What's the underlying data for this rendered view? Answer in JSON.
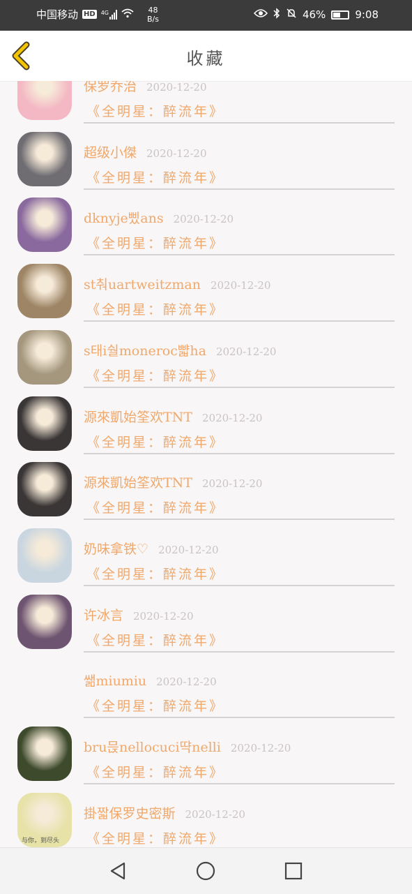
{
  "status_bar": {
    "carrier": "中国移动",
    "hd_badge": "HD",
    "network_type": "4G",
    "speed_value": "48",
    "speed_unit": "B/s",
    "battery_percent": "46%",
    "battery_level": 0.46,
    "time": "9:08"
  },
  "header": {
    "title": "收藏"
  },
  "items": [
    {
      "name": "保罗乔治",
      "date": "2020-12-20",
      "work": "《全明星：醉流年》",
      "avatar": "avatar-pink-girl-icon",
      "avatar_color": "#f4b8c4"
    },
    {
      "name": "超级小傑",
      "date": "2020-12-20",
      "work": "《全明星：醉流年》",
      "avatar": "avatar-girl-portrait-icon",
      "avatar_color": "#6f6c72"
    },
    {
      "name": "dknyje삤ans",
      "date": "2020-12-20",
      "work": "《全明星：醉流年》",
      "avatar": "avatar-purple-hair-girl-icon",
      "avatar_color": "#8a6a9e"
    },
    {
      "name": "st춰uartweitzman",
      "date": "2020-12-20",
      "work": "《全明星：醉流年》",
      "avatar": "avatar-cactus-pot-icon",
      "avatar_color": "#9d8566"
    },
    {
      "name": "s태i숼moneroc뺣ha",
      "date": "2020-12-20",
      "work": "《全明星：醉流年》",
      "avatar": "avatar-sea-sunset-icon",
      "avatar_color": "#a4977e"
    },
    {
      "name": "源來凱始筌欢TNT",
      "date": "2020-12-20",
      "work": "《全明星：醉流年》",
      "avatar": "avatar-group-photo-icon",
      "avatar_color": "#3a3636"
    },
    {
      "name": "源來凱始筌欢TNT",
      "date": "2020-12-20",
      "work": "《全明星：醉流年》",
      "avatar": "avatar-group-photo-icon",
      "avatar_color": "#3a3636"
    },
    {
      "name": "奶味拿铁♡",
      "date": "2020-12-20",
      "work": "《全明星：醉流年》",
      "avatar": "avatar-cartoon-boys-icon",
      "avatar_color": "#c9d6e0"
    },
    {
      "name": "许冰言",
      "date": "2020-12-20",
      "work": "《全明星：醉流年》",
      "avatar": "avatar-couple-purple-icon",
      "avatar_color": "#6d5470"
    },
    {
      "name": "쌞miumiu",
      "date": "2020-12-20",
      "work": "《全明星：醉流年》",
      "avatar": "",
      "avatar_color": ""
    },
    {
      "name": "bru믅nellocuci땩nelli",
      "date": "2020-12-20",
      "work": "《全明星：醉流年》",
      "avatar": "avatar-curly-hair-girl-icon",
      "avatar_color": "#3e4a2c"
    },
    {
      "name": "掛짧保罗史密斯",
      "date": "2020-12-20",
      "work": "《全明星：醉流年》",
      "avatar": "avatar-boy-yellow-icon",
      "avatar_color": "#e6e2a8",
      "avatar_caption": "与你，到尽头"
    }
  ],
  "nav": {
    "icons": [
      "back-triangle-icon",
      "home-circle-icon",
      "recents-square-icon"
    ]
  }
}
